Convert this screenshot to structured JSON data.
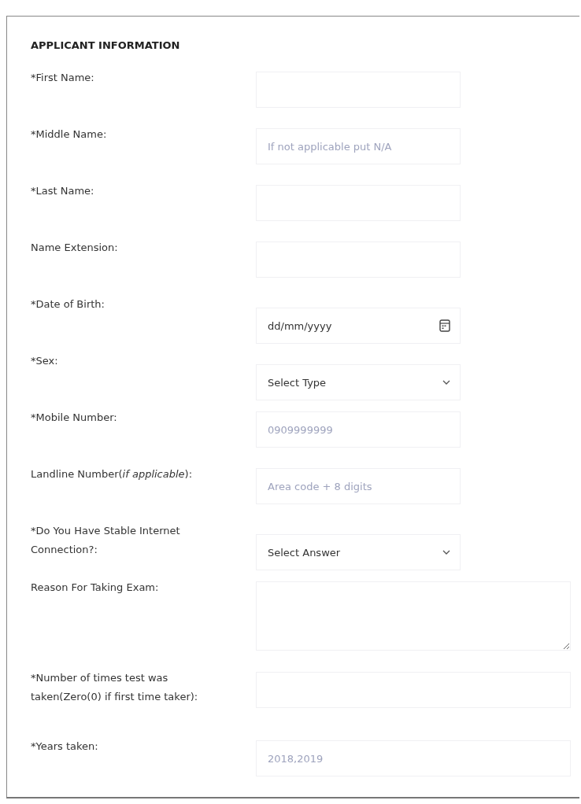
{
  "section_title": "APPLICANT INFORMATION",
  "fields": [
    {
      "label": "*First Name:",
      "kind": "text"
    },
    {
      "label": "*Middle Name:",
      "kind": "text",
      "placeholder": "If not applicable put N/A"
    },
    {
      "label": "*Last Name:",
      "kind": "text"
    },
    {
      "label": "Name Extension:",
      "kind": "text"
    },
    {
      "label": "*Date of Birth:",
      "kind": "date",
      "value": "dd/mm/yyyy"
    },
    {
      "label": "*Sex:",
      "kind": "select",
      "value": "Select Type"
    },
    {
      "label": "*Mobile Number:",
      "kind": "text",
      "placeholder": "0909999999"
    },
    {
      "label": "Landline Number(*if applicable*):",
      "kind": "text",
      "placeholder": "Area code + 8 digits"
    },
    {
      "label": "*Do You Have Stable Internet Connection?:",
      "kind": "select",
      "value": "Select Answer"
    },
    {
      "label": "Reason For Taking Exam:",
      "kind": "textarea"
    },
    {
      "label": "*Number of times test was taken(Zero(0) if first time taker):",
      "kind": "wide"
    },
    {
      "label": "*Years taken:",
      "kind": "wide",
      "placeholder": "2018,2019"
    }
  ]
}
